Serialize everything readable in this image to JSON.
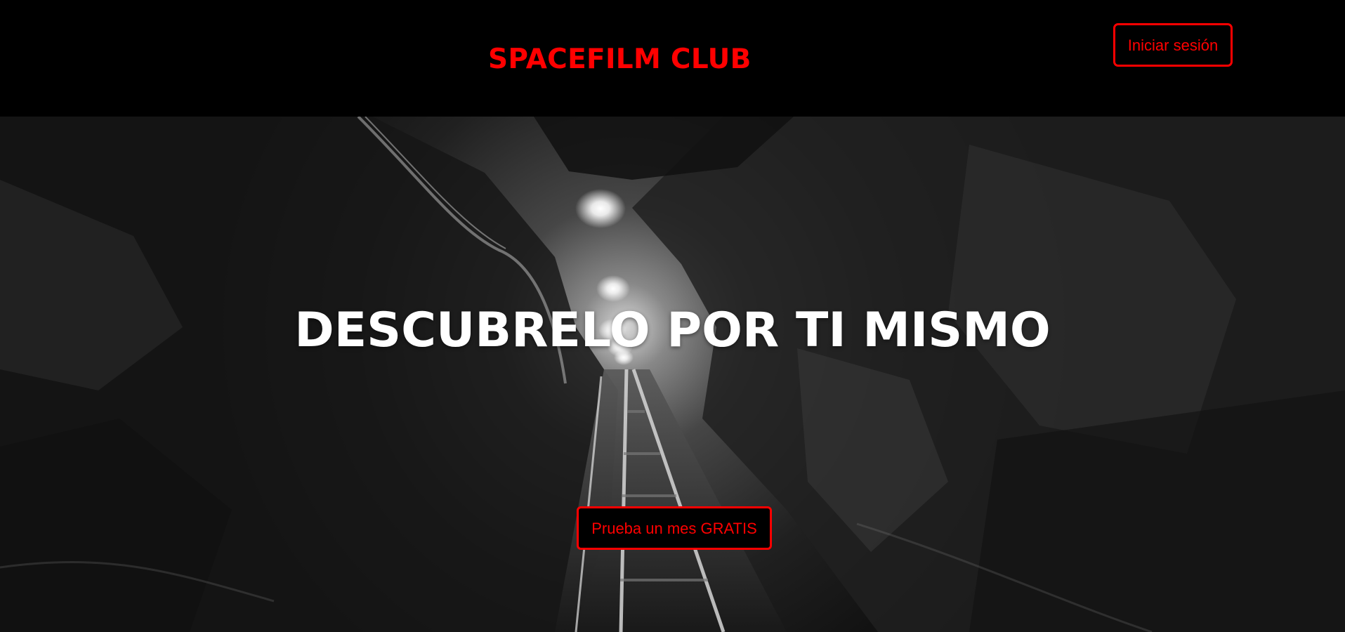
{
  "header": {
    "brand": "SPACEFILM CLUB",
    "login_label": "Iniciar sesión"
  },
  "hero": {
    "title": "DESCUBRELO POR TI MISMO",
    "cta_label": "Prueba un mes GRATIS",
    "background_image": "mine-tunnel-photo"
  },
  "colors": {
    "accent": "#ff0000",
    "header_bg": "#000000",
    "title": "#ffffff"
  }
}
